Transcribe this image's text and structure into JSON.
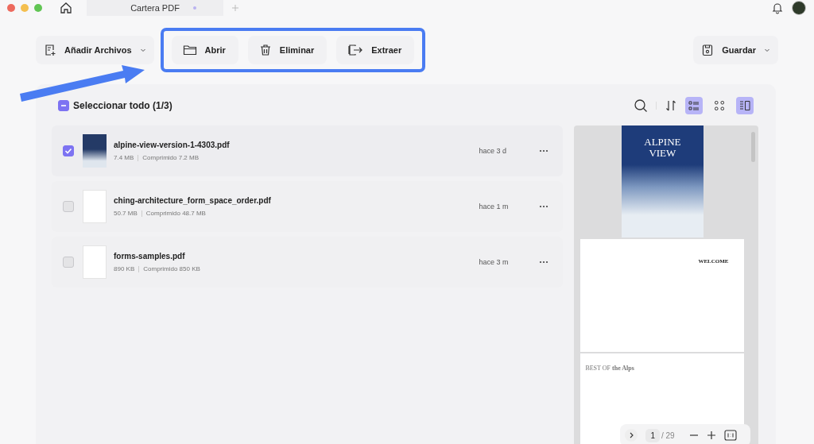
{
  "window": {
    "tab": {
      "title": "Cartera PDF"
    }
  },
  "toolbar": {
    "add_files": "Añadir Archivos",
    "actions": [
      {
        "label": "Abrir",
        "kind": "open"
      },
      {
        "label": "Eliminar",
        "kind": "delete"
      },
      {
        "label": "Extraer",
        "kind": "extract"
      }
    ],
    "save": "Guardar"
  },
  "list": {
    "select_all": {
      "label": "Seleccionar todo (1/3)",
      "indeterminate": true
    },
    "view_buttons": [
      {
        "kind": "list",
        "selected": true
      },
      {
        "kind": "grid",
        "selected": false
      },
      {
        "kind": "preview",
        "selected": true
      }
    ],
    "files": [
      {
        "name": "alpine-view-version-1-4303.pdf",
        "size": "7.4 MB",
        "compressed": "Comprimido 7.2 MB",
        "time": "hace 3 d",
        "checked": true,
        "kind": "cover"
      },
      {
        "name": "ching-architecture_form_space_order.pdf",
        "size": "50.7 MB",
        "compressed": "Comprimido 48.7 MB",
        "time": "hace 1 m",
        "checked": false,
        "kind": "doc"
      },
      {
        "name": "forms-samples.pdf",
        "size": "890 KB",
        "compressed": "Comprimido 850 KB",
        "time": "hace 3 m",
        "checked": false,
        "kind": "doc"
      }
    ]
  },
  "preview": {
    "pages": [
      {
        "kind": "cover",
        "heading": "ALPINE VIEW"
      },
      {
        "kind": "article",
        "heading": "WELCOME"
      },
      {
        "kind": "feature",
        "heading": "BEST OF **the Alps**"
      }
    ],
    "pager": {
      "page": "1",
      "total": "/ 29"
    }
  }
}
